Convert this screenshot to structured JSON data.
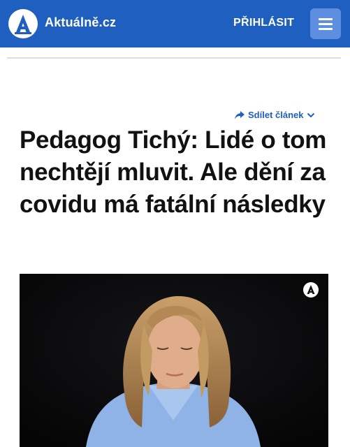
{
  "header": {
    "site_name": "Aktuálně.cz",
    "login_label": "PŘIHLÁSIT",
    "logo_letter": "A",
    "menu_icon": "hamburger-menu-icon"
  },
  "colors": {
    "brand_blue": "#1f5fbf",
    "menu_button": "#5e8ee0",
    "title_text": "#111111"
  },
  "article": {
    "share_label": "Sdílet článek",
    "title": "Pedagog Tichý: Lidé o tom nechtějí mluvit. Ale dění za covidu má fatální následky"
  },
  "video": {
    "watermark_icon": "aktualne-logo-icon"
  }
}
